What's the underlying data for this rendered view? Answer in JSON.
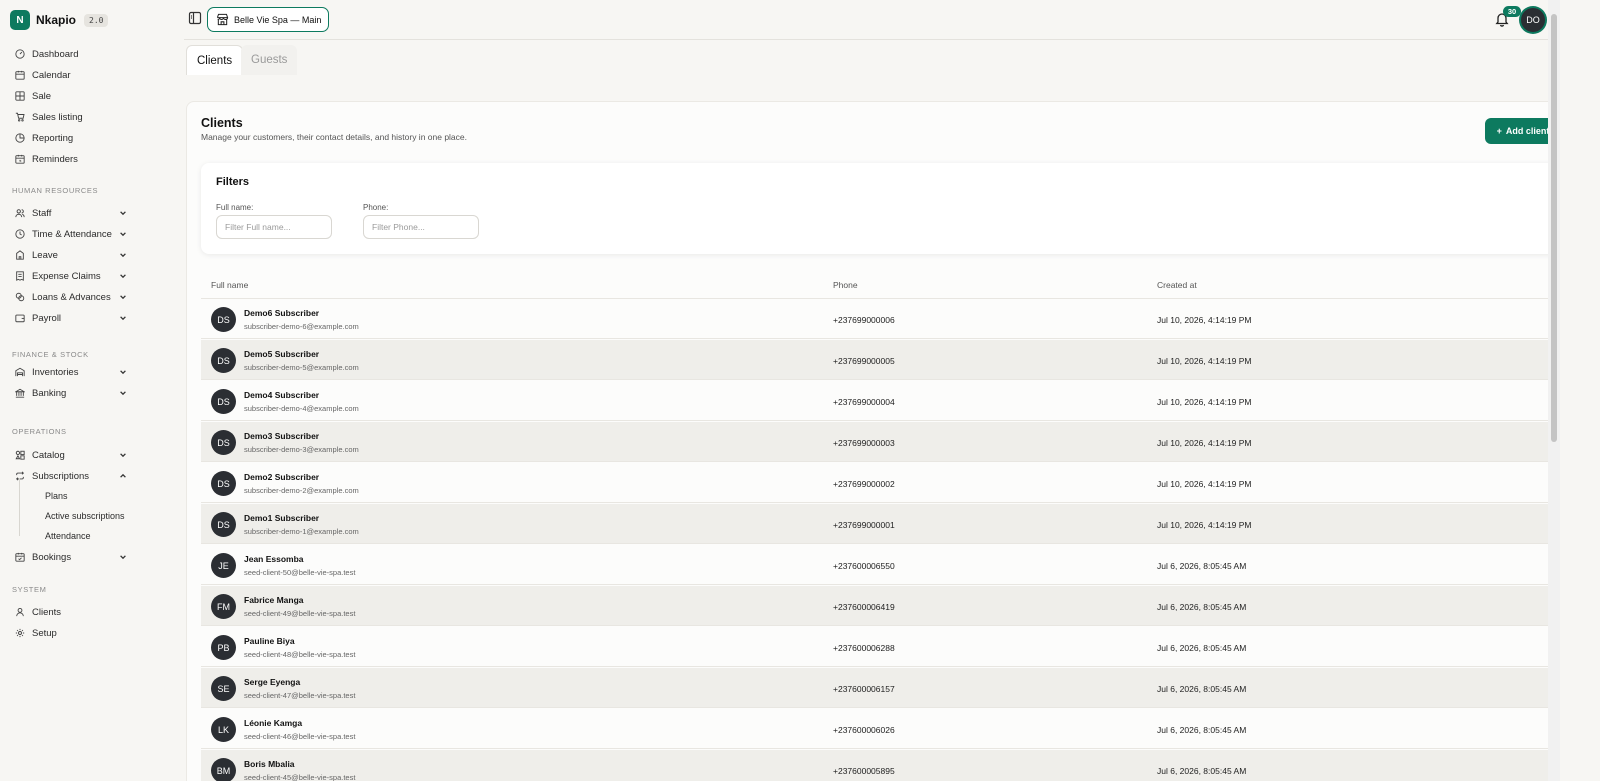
{
  "brand": {
    "name": "Nkapio",
    "version": "2.0",
    "logo_letter": "N",
    "color": "#0d7a5f"
  },
  "sidebar": {
    "main": [
      {
        "label": "Dashboard",
        "icon": "gauge-icon"
      },
      {
        "label": "Calendar",
        "icon": "calendar-icon"
      },
      {
        "label": "Sale",
        "icon": "grid-icon"
      },
      {
        "label": "Sales listing",
        "icon": "cart-icon"
      },
      {
        "label": "Reporting",
        "icon": "chart-icon"
      },
      {
        "label": "Reminders",
        "icon": "calendar-clock-icon"
      }
    ],
    "hr_label": "HUMAN RESOURCES",
    "hr": [
      {
        "label": "Staff",
        "icon": "users-icon"
      },
      {
        "label": "Time & Attendance",
        "icon": "clock-icon"
      },
      {
        "label": "Leave",
        "icon": "leave-icon"
      },
      {
        "label": "Expense Claims",
        "icon": "receipt-icon"
      },
      {
        "label": "Loans & Advances",
        "icon": "coins-icon"
      },
      {
        "label": "Payroll",
        "icon": "wallet-icon"
      }
    ],
    "finance_label": "FINANCE & STOCK",
    "finance": [
      {
        "label": "Inventories",
        "icon": "warehouse-icon"
      },
      {
        "label": "Banking",
        "icon": "bank-icon"
      }
    ],
    "ops_label": "OPERATIONS",
    "ops": [
      {
        "label": "Catalog",
        "icon": "shapes-icon"
      },
      {
        "label": "Subscriptions",
        "icon": "repeat-icon"
      }
    ],
    "subscriptions_sub": [
      "Plans",
      "Active subscriptions",
      "Attendance"
    ],
    "bookings": {
      "label": "Bookings",
      "icon": "calendar-check-icon"
    },
    "system_label": "SYSTEM",
    "system": [
      {
        "label": "Clients",
        "icon": "user-icon"
      },
      {
        "label": "Setup",
        "icon": "settings-icon"
      }
    ]
  },
  "topbar": {
    "branch": "Belle Vie Spa — Main",
    "notifications": "30",
    "avatar": "DO"
  },
  "tabs": [
    {
      "label": "Clients",
      "active": true
    },
    {
      "label": "Guests",
      "active": false
    }
  ],
  "page": {
    "title": "Clients",
    "subtitle": "Manage your customers, their contact details, and history in one place.",
    "add_button": "Add client"
  },
  "filters": {
    "title": "Filters",
    "fullname_label": "Full name:",
    "fullname_placeholder": "Filter Full name...",
    "fullname_value": "",
    "phone_label": "Phone:",
    "phone_placeholder": "Filter Phone...",
    "phone_value": ""
  },
  "table": {
    "headers": [
      "Full name",
      "Phone",
      "Created at"
    ],
    "rows": [
      {
        "initials": "DS",
        "name": "Demo6 Subscriber",
        "email": "subscriber-demo-6@example.com",
        "phone": "+237699000006",
        "created": "Jul 10, 2026, 4:14:19 PM"
      },
      {
        "initials": "DS",
        "name": "Demo5 Subscriber",
        "email": "subscriber-demo-5@example.com",
        "phone": "+237699000005",
        "created": "Jul 10, 2026, 4:14:19 PM"
      },
      {
        "initials": "DS",
        "name": "Demo4 Subscriber",
        "email": "subscriber-demo-4@example.com",
        "phone": "+237699000004",
        "created": "Jul 10, 2026, 4:14:19 PM"
      },
      {
        "initials": "DS",
        "name": "Demo3 Subscriber",
        "email": "subscriber-demo-3@example.com",
        "phone": "+237699000003",
        "created": "Jul 10, 2026, 4:14:19 PM"
      },
      {
        "initials": "DS",
        "name": "Demo2 Subscriber",
        "email": "subscriber-demo-2@example.com",
        "phone": "+237699000002",
        "created": "Jul 10, 2026, 4:14:19 PM"
      },
      {
        "initials": "DS",
        "name": "Demo1 Subscriber",
        "email": "subscriber-demo-1@example.com",
        "phone": "+237699000001",
        "created": "Jul 10, 2026, 4:14:19 PM"
      },
      {
        "initials": "JE",
        "name": "Jean Essomba",
        "email": "seed-client-50@belle-vie-spa.test",
        "phone": "+237600006550",
        "created": "Jul 6, 2026, 8:05:45 AM"
      },
      {
        "initials": "FM",
        "name": "Fabrice Manga",
        "email": "seed-client-49@belle-vie-spa.test",
        "phone": "+237600006419",
        "created": "Jul 6, 2026, 8:05:45 AM"
      },
      {
        "initials": "PB",
        "name": "Pauline Biya",
        "email": "seed-client-48@belle-vie-spa.test",
        "phone": "+237600006288",
        "created": "Jul 6, 2026, 8:05:45 AM"
      },
      {
        "initials": "SE",
        "name": "Serge Eyenga",
        "email": "seed-client-47@belle-vie-spa.test",
        "phone": "+237600006157",
        "created": "Jul 6, 2026, 8:05:45 AM"
      },
      {
        "initials": "LK",
        "name": "Léonie Kamga",
        "email": "seed-client-46@belle-vie-spa.test",
        "phone": "+237600006026",
        "created": "Jul 6, 2026, 8:05:45 AM"
      },
      {
        "initials": "BM",
        "name": "Boris Mbalia",
        "email": "seed-client-45@belle-vie-spa.test",
        "phone": "+237600005895",
        "created": "Jul 6, 2026, 8:05:45 AM"
      }
    ]
  }
}
